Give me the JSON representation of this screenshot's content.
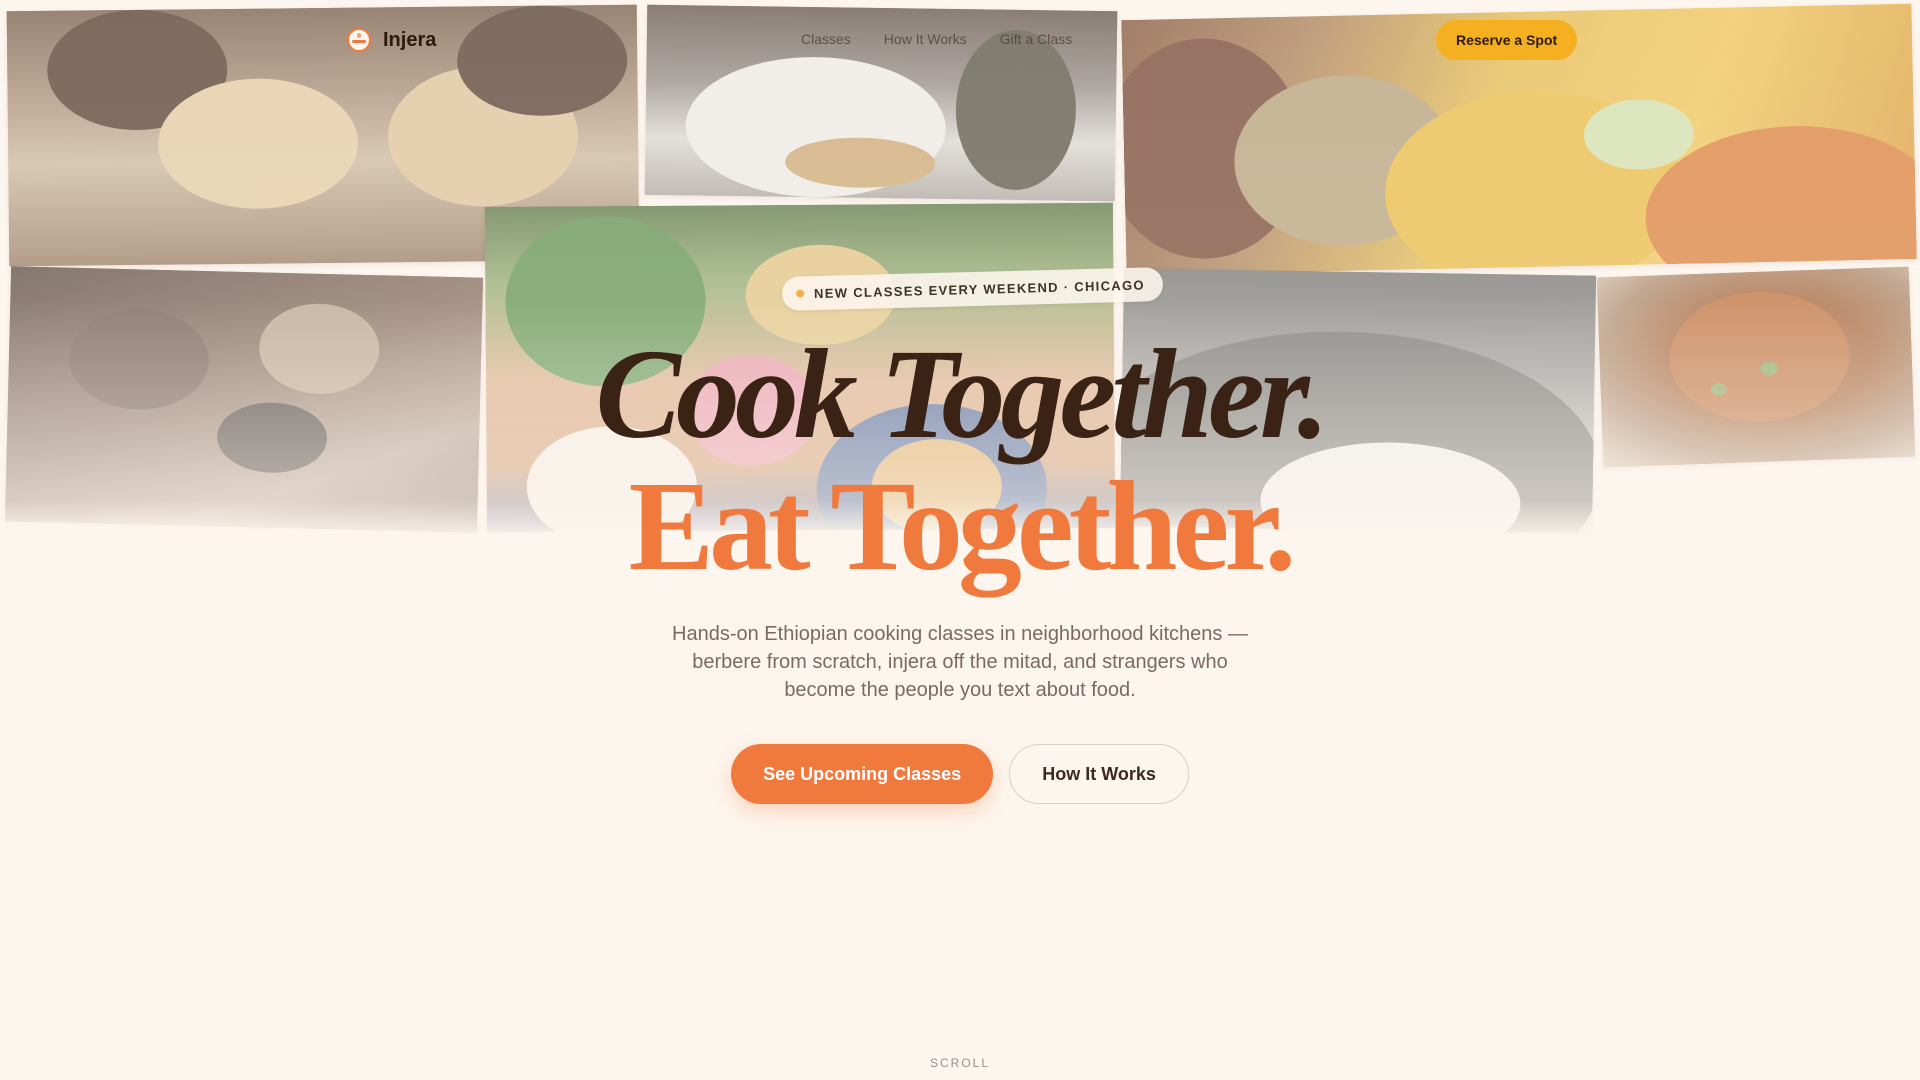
{
  "nav": {
    "brand": "Injera",
    "brand_icon": "bowl-icon",
    "links": [
      "Classes",
      "How It Works",
      "Gift a Class"
    ],
    "reserve_label": "Reserve a Spot"
  },
  "hero": {
    "badge": "NEW CLASSES EVERY WEEKEND · CHICAGO",
    "headline_1": "Cook Together.",
    "headline_2": "Eat Together.",
    "subtitle": "Hands-on Ethiopian cooking classes in neighborhood kitchens — berbere from scratch, injera off the mitad, and strangers who become the people you text about food.",
    "cta_primary": "See Upcoming Classes",
    "cta_secondary": "How It Works",
    "scroll_label": "SCROLL"
  },
  "colors": {
    "accent": "#f07a3e",
    "reserve_button": "#f5b021",
    "background": "#fdf6ee",
    "headline_dark": "#3a2214"
  },
  "collage_images": [
    "injera-tearing-photo",
    "steaming-mitad-photo",
    "spice-market-photo",
    "phone-food-photo",
    "food-plate-photo",
    "black-and-white-pot-photo",
    "spice-bowl-photo"
  ]
}
